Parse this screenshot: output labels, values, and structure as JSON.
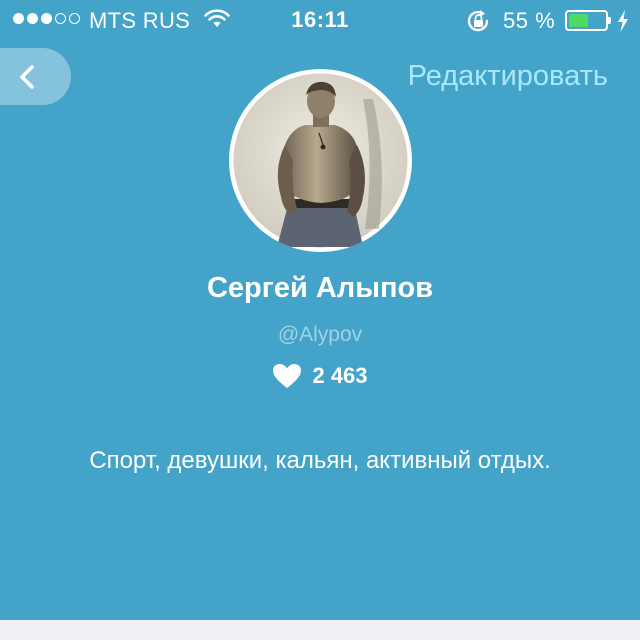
{
  "status_bar": {
    "signal_strength": 3,
    "signal_total": 5,
    "carrier": "MTS RUS",
    "time": "16:11",
    "battery_percent": "55 %",
    "battery_level": 0.55,
    "battery_color": "#4cd964",
    "wifi_icon": "wifi-icon",
    "rotation_lock_icon": "rotation-lock-icon",
    "charging_icon": "charging-bolt-icon"
  },
  "header": {
    "back_icon": "chevron-left-icon",
    "edit_label": "Редактировать"
  },
  "profile": {
    "avatar": "profile-photo",
    "name": "Сергей Алыпов",
    "username": "@Alypov",
    "likes_icon": "heart-icon",
    "likes_count": "2 463",
    "bio": "Спорт, девушки, кальян, активный отдых."
  },
  "colors": {
    "background": "#44a3c9",
    "edit_link": "#a8e8fa",
    "username": "#9fd2e6"
  }
}
